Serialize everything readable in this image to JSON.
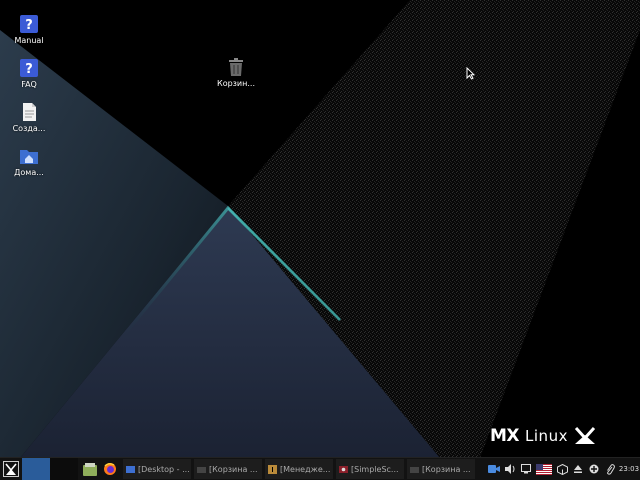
{
  "desktop": {
    "icons": [
      {
        "label": "Manual",
        "icon": "help-icon"
      },
      {
        "label": "FAQ",
        "icon": "help-icon"
      },
      {
        "label": "Созда...",
        "icon": "document-icon"
      },
      {
        "label": "Дома...",
        "icon": "home-folder-icon"
      },
      {
        "label": "Корзин...",
        "icon": "trash-icon"
      }
    ],
    "logo_text": "Linux",
    "logo_mark": "MX"
  },
  "taskbar": {
    "tasks": [
      {
        "label": "[Desktop - ...",
        "icon": "desktop-icon"
      },
      {
        "label": "[Корзина ...",
        "icon": "folder-icon"
      },
      {
        "label": "[Менедже...",
        "icon": "info-icon"
      },
      {
        "label": "[SimpleSc...",
        "icon": "screenshot-icon"
      },
      {
        "label": "[Корзина ...",
        "icon": "folder-icon"
      }
    ],
    "clock": "23:03",
    "keyboard_layout": "US"
  },
  "colors": {
    "accent": "#4fd6cf",
    "taskbar": "#121212",
    "workspace_active": "#2a5c9a"
  }
}
